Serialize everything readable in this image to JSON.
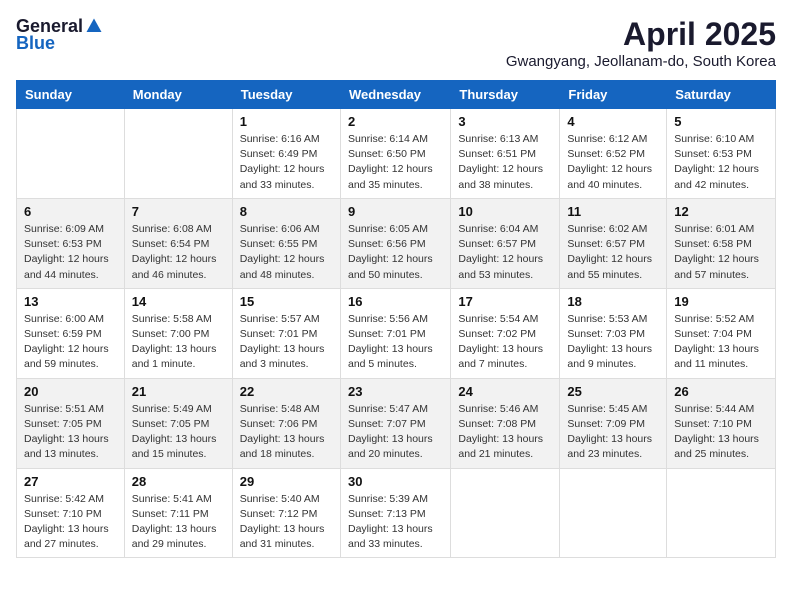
{
  "logo": {
    "general": "General",
    "blue": "Blue"
  },
  "title": {
    "month_year": "April 2025",
    "location": "Gwangyang, Jeollanam-do, South Korea"
  },
  "days_of_week": [
    "Sunday",
    "Monday",
    "Tuesday",
    "Wednesday",
    "Thursday",
    "Friday",
    "Saturday"
  ],
  "weeks": [
    [
      {
        "day": "",
        "info": ""
      },
      {
        "day": "",
        "info": ""
      },
      {
        "day": "1",
        "info": "Sunrise: 6:16 AM\nSunset: 6:49 PM\nDaylight: 12 hours\nand 33 minutes."
      },
      {
        "day": "2",
        "info": "Sunrise: 6:14 AM\nSunset: 6:50 PM\nDaylight: 12 hours\nand 35 minutes."
      },
      {
        "day": "3",
        "info": "Sunrise: 6:13 AM\nSunset: 6:51 PM\nDaylight: 12 hours\nand 38 minutes."
      },
      {
        "day": "4",
        "info": "Sunrise: 6:12 AM\nSunset: 6:52 PM\nDaylight: 12 hours\nand 40 minutes."
      },
      {
        "day": "5",
        "info": "Sunrise: 6:10 AM\nSunset: 6:53 PM\nDaylight: 12 hours\nand 42 minutes."
      }
    ],
    [
      {
        "day": "6",
        "info": "Sunrise: 6:09 AM\nSunset: 6:53 PM\nDaylight: 12 hours\nand 44 minutes."
      },
      {
        "day": "7",
        "info": "Sunrise: 6:08 AM\nSunset: 6:54 PM\nDaylight: 12 hours\nand 46 minutes."
      },
      {
        "day": "8",
        "info": "Sunrise: 6:06 AM\nSunset: 6:55 PM\nDaylight: 12 hours\nand 48 minutes."
      },
      {
        "day": "9",
        "info": "Sunrise: 6:05 AM\nSunset: 6:56 PM\nDaylight: 12 hours\nand 50 minutes."
      },
      {
        "day": "10",
        "info": "Sunrise: 6:04 AM\nSunset: 6:57 PM\nDaylight: 12 hours\nand 53 minutes."
      },
      {
        "day": "11",
        "info": "Sunrise: 6:02 AM\nSunset: 6:57 PM\nDaylight: 12 hours\nand 55 minutes."
      },
      {
        "day": "12",
        "info": "Sunrise: 6:01 AM\nSunset: 6:58 PM\nDaylight: 12 hours\nand 57 minutes."
      }
    ],
    [
      {
        "day": "13",
        "info": "Sunrise: 6:00 AM\nSunset: 6:59 PM\nDaylight: 12 hours\nand 59 minutes."
      },
      {
        "day": "14",
        "info": "Sunrise: 5:58 AM\nSunset: 7:00 PM\nDaylight: 13 hours\nand 1 minute."
      },
      {
        "day": "15",
        "info": "Sunrise: 5:57 AM\nSunset: 7:01 PM\nDaylight: 13 hours\nand 3 minutes."
      },
      {
        "day": "16",
        "info": "Sunrise: 5:56 AM\nSunset: 7:01 PM\nDaylight: 13 hours\nand 5 minutes."
      },
      {
        "day": "17",
        "info": "Sunrise: 5:54 AM\nSunset: 7:02 PM\nDaylight: 13 hours\nand 7 minutes."
      },
      {
        "day": "18",
        "info": "Sunrise: 5:53 AM\nSunset: 7:03 PM\nDaylight: 13 hours\nand 9 minutes."
      },
      {
        "day": "19",
        "info": "Sunrise: 5:52 AM\nSunset: 7:04 PM\nDaylight: 13 hours\nand 11 minutes."
      }
    ],
    [
      {
        "day": "20",
        "info": "Sunrise: 5:51 AM\nSunset: 7:05 PM\nDaylight: 13 hours\nand 13 minutes."
      },
      {
        "day": "21",
        "info": "Sunrise: 5:49 AM\nSunset: 7:05 PM\nDaylight: 13 hours\nand 15 minutes."
      },
      {
        "day": "22",
        "info": "Sunrise: 5:48 AM\nSunset: 7:06 PM\nDaylight: 13 hours\nand 18 minutes."
      },
      {
        "day": "23",
        "info": "Sunrise: 5:47 AM\nSunset: 7:07 PM\nDaylight: 13 hours\nand 20 minutes."
      },
      {
        "day": "24",
        "info": "Sunrise: 5:46 AM\nSunset: 7:08 PM\nDaylight: 13 hours\nand 21 minutes."
      },
      {
        "day": "25",
        "info": "Sunrise: 5:45 AM\nSunset: 7:09 PM\nDaylight: 13 hours\nand 23 minutes."
      },
      {
        "day": "26",
        "info": "Sunrise: 5:44 AM\nSunset: 7:10 PM\nDaylight: 13 hours\nand 25 minutes."
      }
    ],
    [
      {
        "day": "27",
        "info": "Sunrise: 5:42 AM\nSunset: 7:10 PM\nDaylight: 13 hours\nand 27 minutes."
      },
      {
        "day": "28",
        "info": "Sunrise: 5:41 AM\nSunset: 7:11 PM\nDaylight: 13 hours\nand 29 minutes."
      },
      {
        "day": "29",
        "info": "Sunrise: 5:40 AM\nSunset: 7:12 PM\nDaylight: 13 hours\nand 31 minutes."
      },
      {
        "day": "30",
        "info": "Sunrise: 5:39 AM\nSunset: 7:13 PM\nDaylight: 13 hours\nand 33 minutes."
      },
      {
        "day": "",
        "info": ""
      },
      {
        "day": "",
        "info": ""
      },
      {
        "day": "",
        "info": ""
      }
    ]
  ]
}
